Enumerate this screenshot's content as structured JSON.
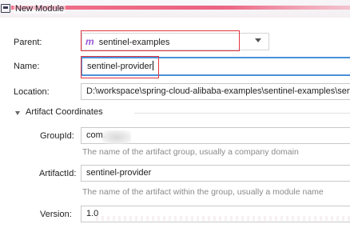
{
  "window": {
    "title": "New Module"
  },
  "form": {
    "parent": {
      "label": "Parent:",
      "value": "sentinel-examples",
      "icon": "maven-m-icon"
    },
    "name": {
      "label": "Name:",
      "value": "sentinel-provider"
    },
    "location": {
      "label": "Location:",
      "value": "D:\\workspace\\spring-cloud-alibaba-examples\\sentinel-examples\\sen"
    }
  },
  "artifact": {
    "section_title": "Artifact Coordinates",
    "group_id": {
      "label": "GroupId:",
      "value": "com.",
      "hint": "The name of the artifact group, usually a company domain"
    },
    "artifact_id": {
      "label": "ArtifactId:",
      "value": "sentinel-provider",
      "hint": "The name of the artifact within the group, usually a module name"
    },
    "version": {
      "label": "Version:",
      "value": "1.0"
    }
  },
  "colors": {
    "highlight_box": "#e03640",
    "focus_border": "#4a90d9",
    "maven_icon": "#9b59d6"
  }
}
